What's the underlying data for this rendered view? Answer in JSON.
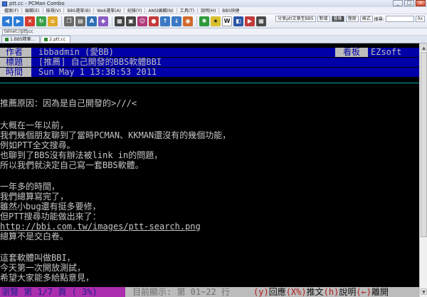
{
  "window": {
    "title": "ptt.cc - PCMan Combo",
    "minimize": "_",
    "maximize": "□",
    "close": "×"
  },
  "menu": [
    "檔案(F)",
    "編輯(E)",
    "檢視(V)",
    "BBS選單(B)",
    "Web選單(A)",
    "紀錄(Y)",
    "ANSI編輯(N)",
    "工具(T)",
    "說明(H)",
    "BBS快捷"
  ],
  "toolbar": {
    "share_label": "分享ptt文章至BBS",
    "btn_a": "新增",
    "btn_b": "圖像",
    "btn_c": "復原",
    "btn_d": "格式",
    "btn_e": "搜尋:",
    "zoom": "0x"
  },
  "address": {
    "value": "telnet://ptt.cc"
  },
  "tabs": [
    {
      "label": "1.BBS精華..."
    },
    {
      "label": "2.ptt.cc"
    }
  ],
  "header": {
    "author_key": "作者",
    "author_val": "ibbadmin (愛BB)",
    "board_key": "看板",
    "board_val": "EZsoft",
    "title_key": "標題",
    "title_val": "[推薦] 自己開發的BBS軟體BBI",
    "time_key": "時間",
    "time_val": "Sun May  1 13:38:53 2011"
  },
  "body": [
    "推薦原因：因為是自己開發的>///<",
    "大概在一年以前，",
    "我們幾個朋友聊到了當時PCMAN、KKMAN還沒有的幾個功能，",
    "例如PTT全文搜尋。",
    "也聊到了BBS沒有辦法被link in的問題，",
    "所以我們就決定自己寫一套BBS軟體。",
    "一年多的時間，",
    "我們總算寫完了，",
    "雖然小bug還有挺多要修，",
    "但PTT搜尋功能做出來了：",
    "http://bbi.com.tw/images/ptt-search.png",
    "總算不是交白卷。",
    "這套軟體叫做BBI，",
    "今天第一次開放測試，",
    "希望大家能多給點意見，"
  ],
  "status": {
    "page": "  瀏覽 第 1/7 頁 ( 3%)",
    "range": "目前顯示: 第 01~22 行",
    "reply_key": "(y)",
    "reply_lbl": "回應",
    "push_key": "(X%)",
    "push_lbl": "推文",
    "help_key": "(h)",
    "help_lbl": "說明",
    "leave_key": "(←)",
    "leave_lbl": "離開"
  }
}
